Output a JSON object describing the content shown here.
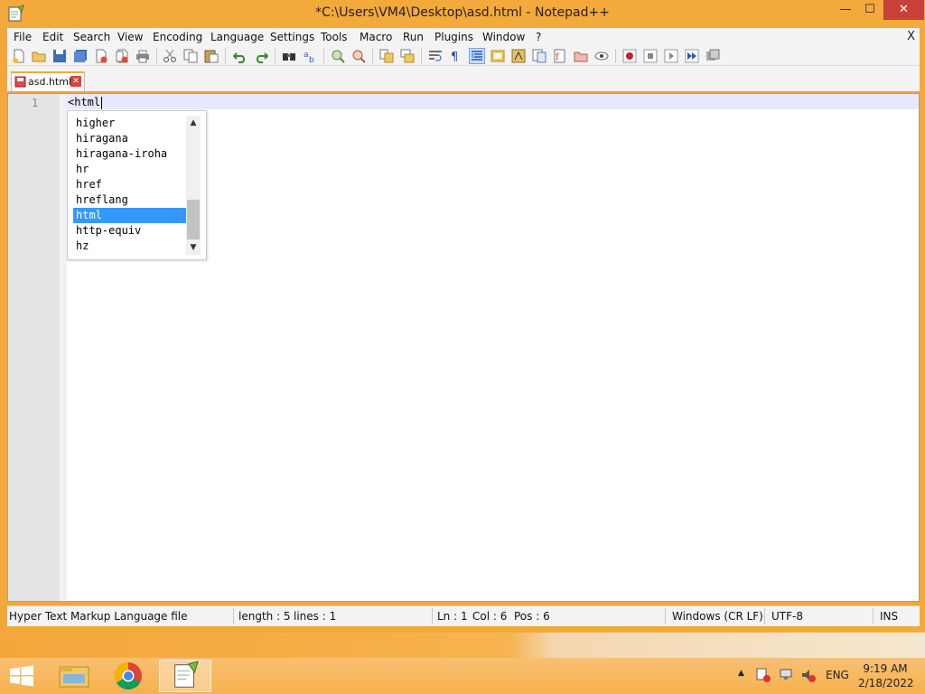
{
  "window": {
    "title": "*C:\\Users\\VM4\\Desktop\\asd.html - Notepad++",
    "min_glyph": "—",
    "max_glyph": "☐",
    "close_glyph": "✕"
  },
  "menu": {
    "items": [
      "File",
      "Edit",
      "Search",
      "View",
      "Encoding",
      "Language",
      "Settings",
      "Tools",
      "Macro",
      "Run",
      "Plugins",
      "Window",
      "?"
    ],
    "close_label": "X"
  },
  "toolbar": {
    "icons": [
      "new-file-icon",
      "open-file-icon",
      "save-icon",
      "save-all-icon",
      "close-icon",
      "close-all-icon",
      "print-icon",
      "cut-icon",
      "copy-icon",
      "paste-icon",
      "undo-icon",
      "redo-icon",
      "find-icon",
      "replace-icon",
      "zoom-in-icon",
      "zoom-out-icon",
      "sync-vertical-icon",
      "sync-horizontal-icon",
      "word-wrap-icon",
      "show-all-chars-icon",
      "indent-guide-icon",
      "user-defined-language-icon",
      "document-map-icon",
      "function-list-icon",
      "folder-as-workspace-icon",
      "monitoring-icon",
      "record-macro-icon",
      "stop-record-icon",
      "playback-macro-icon",
      "run-macro-multiple-icon",
      "save-macro-icon"
    ]
  },
  "tab": {
    "label": "asd.html",
    "close_glyph": "✕"
  },
  "editor": {
    "line_number": "1",
    "code": "<html"
  },
  "autocomplete": {
    "items": [
      "higher",
      "hiragana",
      "hiragana-iroha",
      "hr",
      "href",
      "hreflang",
      "html",
      "http-equiv",
      "hz"
    ],
    "selected_index": 6,
    "up_glyph": "▲",
    "down_glyph": "▼"
  },
  "statusbar": {
    "file_type": "Hyper Text Markup Language file",
    "length": "length : 5",
    "lines": "lines : 1",
    "ln": "Ln : 1",
    "col": "Col : 6",
    "pos": "Pos : 6",
    "eol": "Windows (CR LF)",
    "encoding": "UTF-8",
    "mode": "INS"
  },
  "taskbar": {
    "apps": [
      "file-explorer-icon",
      "chrome-icon",
      "notepad-plus-plus-icon"
    ],
    "language": "ENG",
    "time": "9:19 AM",
    "date": "2/18/2022",
    "tray_up_glyph": "▲"
  },
  "colors": {
    "accent": "#f4a93c",
    "selection": "#3399ff",
    "current_line": "#e8e8ff",
    "close_red": "#c7403a"
  }
}
